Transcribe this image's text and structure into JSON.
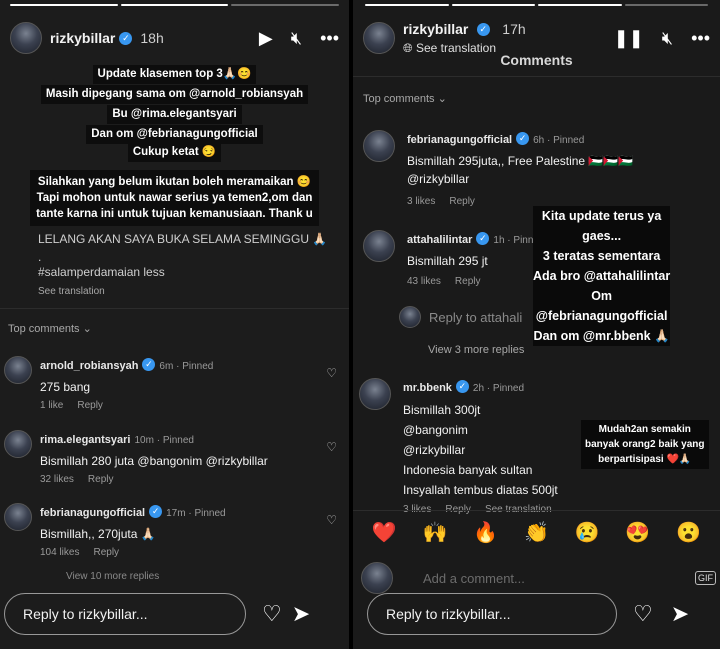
{
  "left": {
    "header": {
      "username": "rizkybillar",
      "time": "18h"
    },
    "caption": {
      "lines": [
        "Update klasemen  top 3🙏🏻😊",
        "Masih dipegang sama om @arnold_robiansyah",
        "Bu @rima.elegantsyari",
        "Dan om @febrianagungofficial"
      ],
      "cukup": "Cukup ketat 😏",
      "block": "Silahkan yang belum ikutan boleh meramaikan 😊\nTapi mohon untuk nawar serius ya temen2,om dan\ntante karna ini untuk tujuan kemanusiaan. Thank u"
    },
    "post": {
      "line1": "LELANG AKAN SAYA BUKA SELAMA SEMINGGU 🙏🏻",
      "line2": ".",
      "line3": "#salamperdamaian less",
      "see_translation": "See translation"
    },
    "top_comments": "Top comments ⌄",
    "comments": [
      {
        "user": "arnold_robiansyah",
        "meta": "6m · Pinned",
        "text": "275 bang",
        "likes": "1 like",
        "reply": "Reply"
      },
      {
        "user": "rima.elegantsyari",
        "meta": "10m · Pinned",
        "text": "Bismillah 280 juta @bangonim @rizkybillar",
        "likes": "32 likes",
        "reply": "Reply"
      },
      {
        "user": "febrianagungofficial",
        "meta": "17m · Pinned",
        "text": "Bismillah,, 270juta 🙏🏻",
        "likes": "104 likes",
        "reply": "Reply"
      }
    ],
    "view_more": "View 10 more replies",
    "reply_placeholder": "Reply to rizkybillar..."
  },
  "right": {
    "header": {
      "username": "rizkybillar",
      "time": "17h",
      "see_translation": "See translation",
      "comments_title": "Comments"
    },
    "top_comments": "Top comments ⌄",
    "comments": [
      {
        "user": "febrianagungofficial",
        "meta": "6h · Pinned",
        "text": "Bismillah 295juta,, Free Palestine 🇵🇸🇵🇸🇵🇸\n@rizkybillar",
        "likes": "3 likes",
        "reply": "Reply"
      },
      {
        "user": "attahalilintar",
        "meta": "1h · Pinned",
        "text": "Bismillah 295 jt",
        "likes": "43 likes",
        "reply": "Reply"
      },
      {
        "user": "mr.bbenk",
        "meta": "2h · Pinned",
        "text": "Bismillah 300jt\n @bangonim\n@rizkybillar\nIndonesia banyak sultan\nInsyallah tembus diatas 500jt",
        "likes": "3 likes",
        "reply": "Reply",
        "see_translation": "See translation"
      }
    ],
    "reply_to_attah": "Reply to attahali",
    "view_3_more": "View 3 more replies",
    "overlay_text": "Kita update terus ya\ngaes...\n3 teratas sementara\nAda bro @attahalilintar\nOm\n@febrianagungofficial\nDan om @mr.bbenk 🙏🏻",
    "overlay_small": "Mudah2an semakin\nbanyak orang2 baik yang\nberpartisipasi ❤️🙏🏻",
    "reactions": [
      "❤️",
      "🙌",
      "🔥",
      "👏",
      "😢",
      "😍",
      "😮"
    ],
    "add_comment": "Add a comment...",
    "gif": "GIF",
    "reply_placeholder": "Reply to rizkybillar..."
  }
}
